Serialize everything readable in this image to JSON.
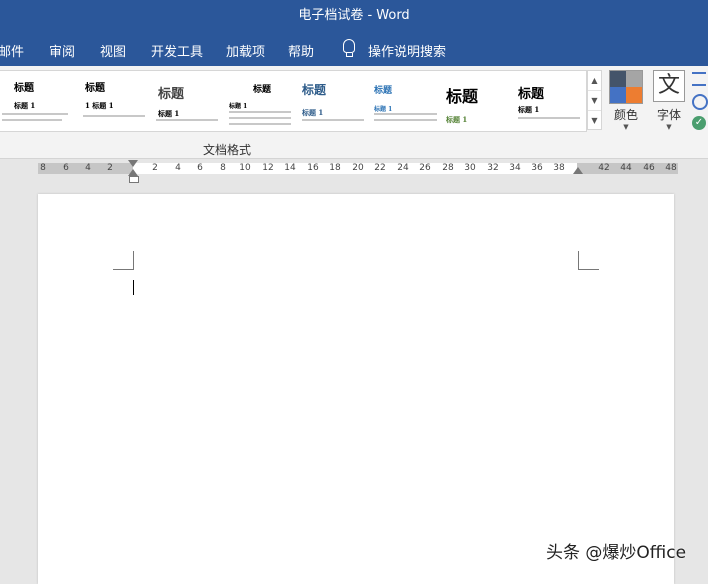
{
  "window": {
    "title": "电子档试卷 - Word"
  },
  "tabs": [
    "邮件",
    "审阅",
    "视图",
    "开发工具",
    "加载项",
    "帮助"
  ],
  "tell_me": {
    "label": "操作说明搜索"
  },
  "styles_gallery": {
    "items": [
      {
        "title": "标题",
        "heading1": "标题 1"
      },
      {
        "title": "标题",
        "heading1": "1 标题 1"
      },
      {
        "title": "标题",
        "heading1": "标题 1"
      },
      {
        "title": "标题",
        "heading1": "标题 1"
      },
      {
        "title": "标题",
        "heading1": "标题 1",
        "accent": "#2e5c8a"
      },
      {
        "title": "标题",
        "heading1": "标题 1",
        "accent": "#2e74b5"
      },
      {
        "title": "标题",
        "heading1": "标题 1",
        "accent": "#548235"
      },
      {
        "title": "标题",
        "heading1": "标题 1"
      }
    ]
  },
  "ribbon": {
    "colors_label": "颜色",
    "fonts_label": "字体",
    "group_label": "文档格式"
  },
  "ruler": {
    "labels": [
      "8",
      "6",
      "4",
      "2",
      "2",
      "4",
      "6",
      "8",
      "10",
      "12",
      "14",
      "16",
      "18",
      "20",
      "22",
      "24",
      "26",
      "28",
      "30",
      "32",
      "34",
      "36",
      "38",
      "42",
      "44",
      "46",
      "48"
    ]
  },
  "watermark": "头条 @爆炒Office",
  "colors": {
    "brand": "#2b579a",
    "swatch_dark": "#44546a",
    "swatch_orange": "#ed7d31",
    "swatch_blue": "#4472c4",
    "swatch_gray": "#a5a5a5"
  }
}
